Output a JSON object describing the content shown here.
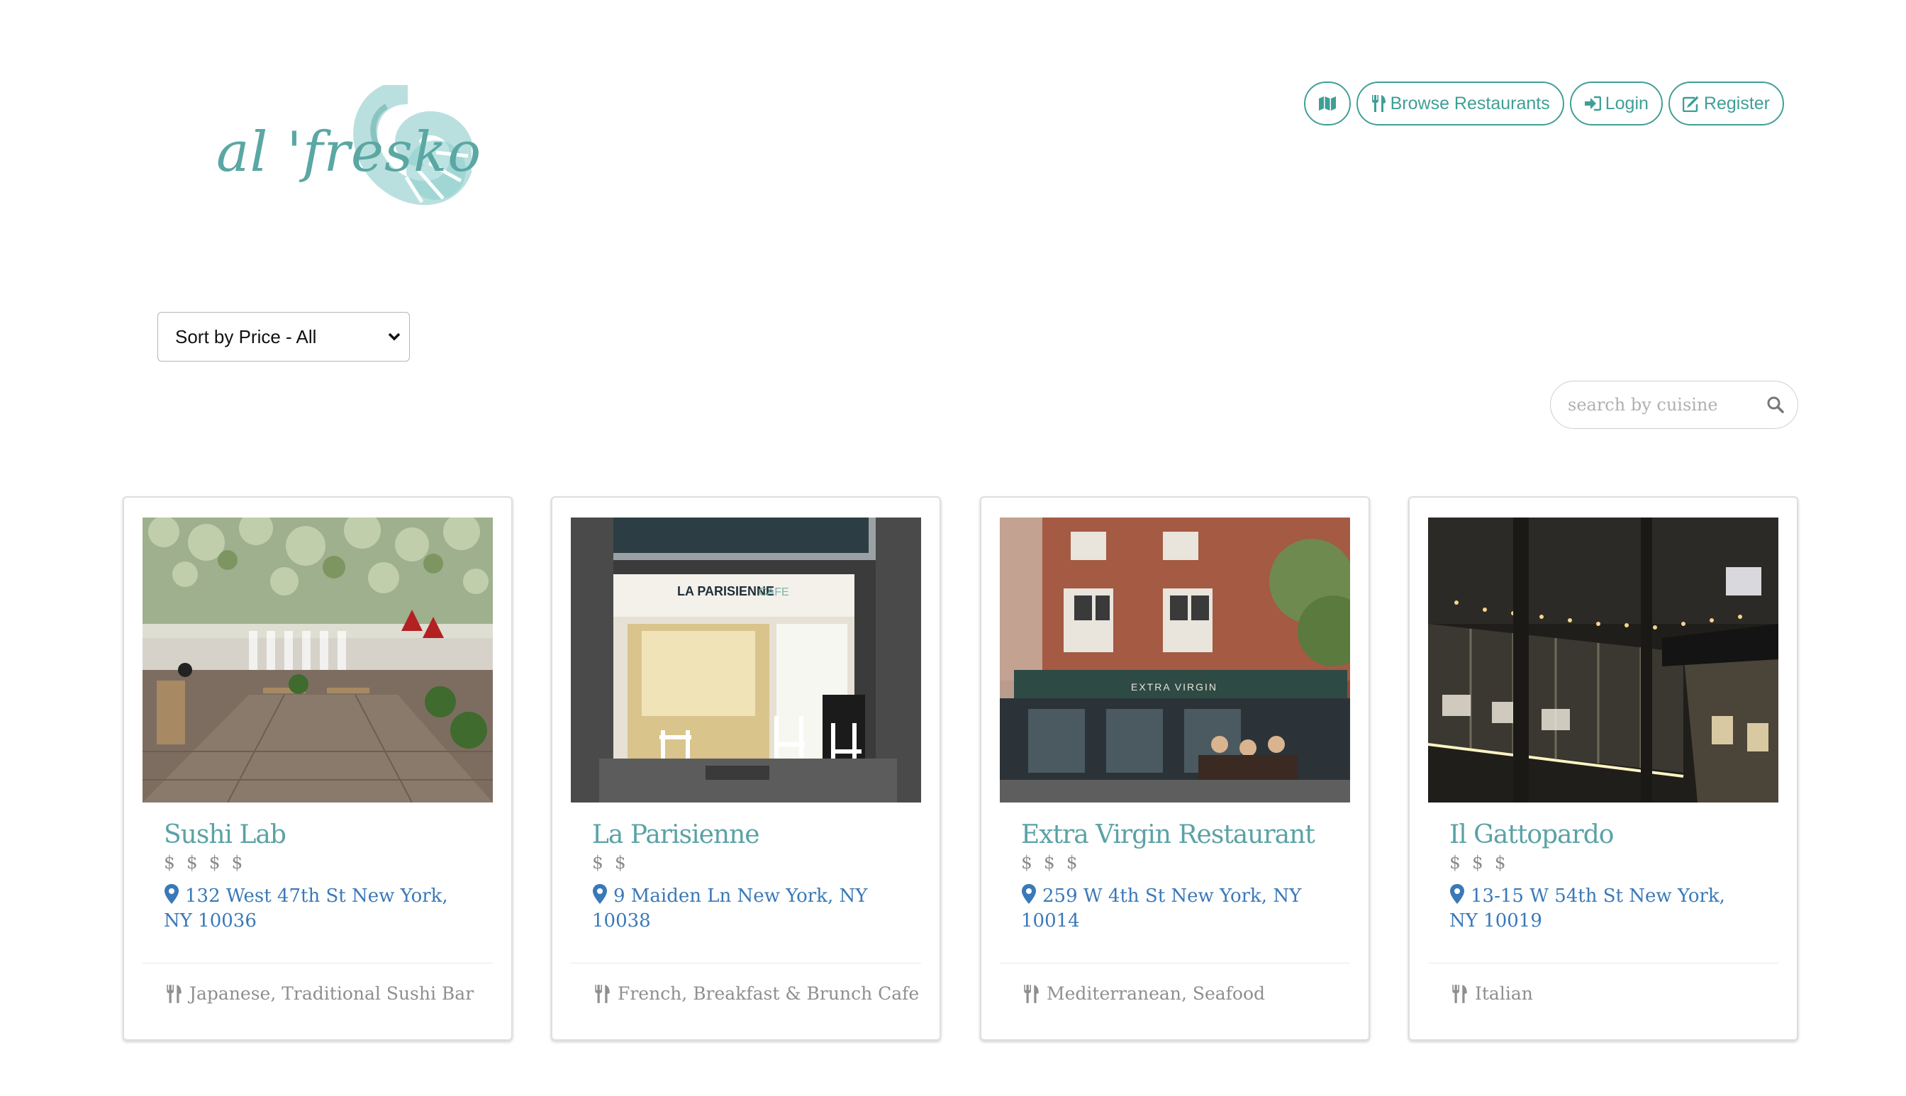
{
  "brand": {
    "name": "al 'fresko",
    "colors": {
      "accent": "#3f9f96",
      "title": "#5aa2a5",
      "address": "#3a79b8",
      "muted": "#8f8f8f"
    }
  },
  "nav": {
    "map_icon": "map-icon",
    "browse_label": "Browse Restaurants",
    "login_label": "Login",
    "register_label": "Register"
  },
  "filters": {
    "sort_selected": "Sort by Price - All",
    "search_placeholder": "search by cuisine"
  },
  "restaurants": [
    {
      "name": "Sushi Lab",
      "price": "$ $ $ $",
      "address": "132 West 47th St New York, NY 10036",
      "cuisine": "Japanese, Traditional Sushi Bar",
      "image_subject": "rooftop-garden-terrace"
    },
    {
      "name": "La Parisienne",
      "price": "$ $",
      "address": "9 Maiden Ln New York, NY 10038",
      "cuisine": "French, Breakfast & Brunch Cafe",
      "image_subject": "cafe-storefront",
      "sign_text": "LA PARISIENNE",
      "sign_text2": "CAFE"
    },
    {
      "name": "Extra Virgin Restaurant",
      "price": "$ $ $",
      "address": "259 W 4th St New York, NY 10014",
      "cuisine": "Mediterranean, Seafood",
      "image_subject": "brick-building-sidewalk-dining",
      "sign_text": "EXTRA VIRGIN"
    },
    {
      "name": "Il Gattopardo",
      "price": "$ $ $",
      "address": "13-15 W 54th St New York, NY 10019",
      "cuisine": "Italian",
      "image_subject": "night-outdoor-dining-enclosure"
    }
  ]
}
